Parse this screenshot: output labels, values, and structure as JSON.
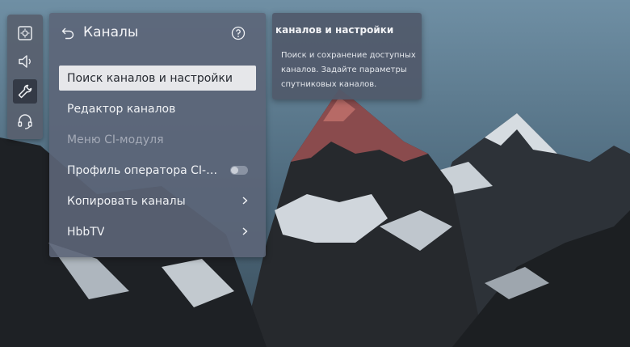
{
  "rail": {
    "items": [
      {
        "icon": "picture-settings-icon",
        "active": false
      },
      {
        "icon": "sound-icon",
        "active": false
      },
      {
        "icon": "wrench-icon",
        "active": true
      },
      {
        "icon": "headset-icon",
        "active": false
      }
    ]
  },
  "panel": {
    "title": "Каналы",
    "back_icon": "back-arrow-icon",
    "help_icon": "help-icon",
    "items": [
      {
        "label": "Поиск каналов и настройки",
        "state": "selected"
      },
      {
        "label": "Редактор каналов",
        "state": "normal"
      },
      {
        "label": "Меню CI-модуля",
        "state": "disabled"
      },
      {
        "label": "Профиль оператора CI-модуля",
        "state": "normal",
        "control": "toggle",
        "toggle_on": false
      },
      {
        "label": "Копировать каналы",
        "state": "normal",
        "control": "chevron"
      },
      {
        "label": "HbbTV",
        "state": "normal",
        "control": "chevron"
      }
    ]
  },
  "description": {
    "title": "каналов и настройки",
    "text": "Поиск и сохранение доступных каналов. Задайте параметры спутниковых каналов."
  },
  "colors": {
    "panel_bg": "#5c6578",
    "selected_bg": "#e6e7ea",
    "text": "#f0f2f5",
    "disabled_text": "#a4aab7"
  }
}
